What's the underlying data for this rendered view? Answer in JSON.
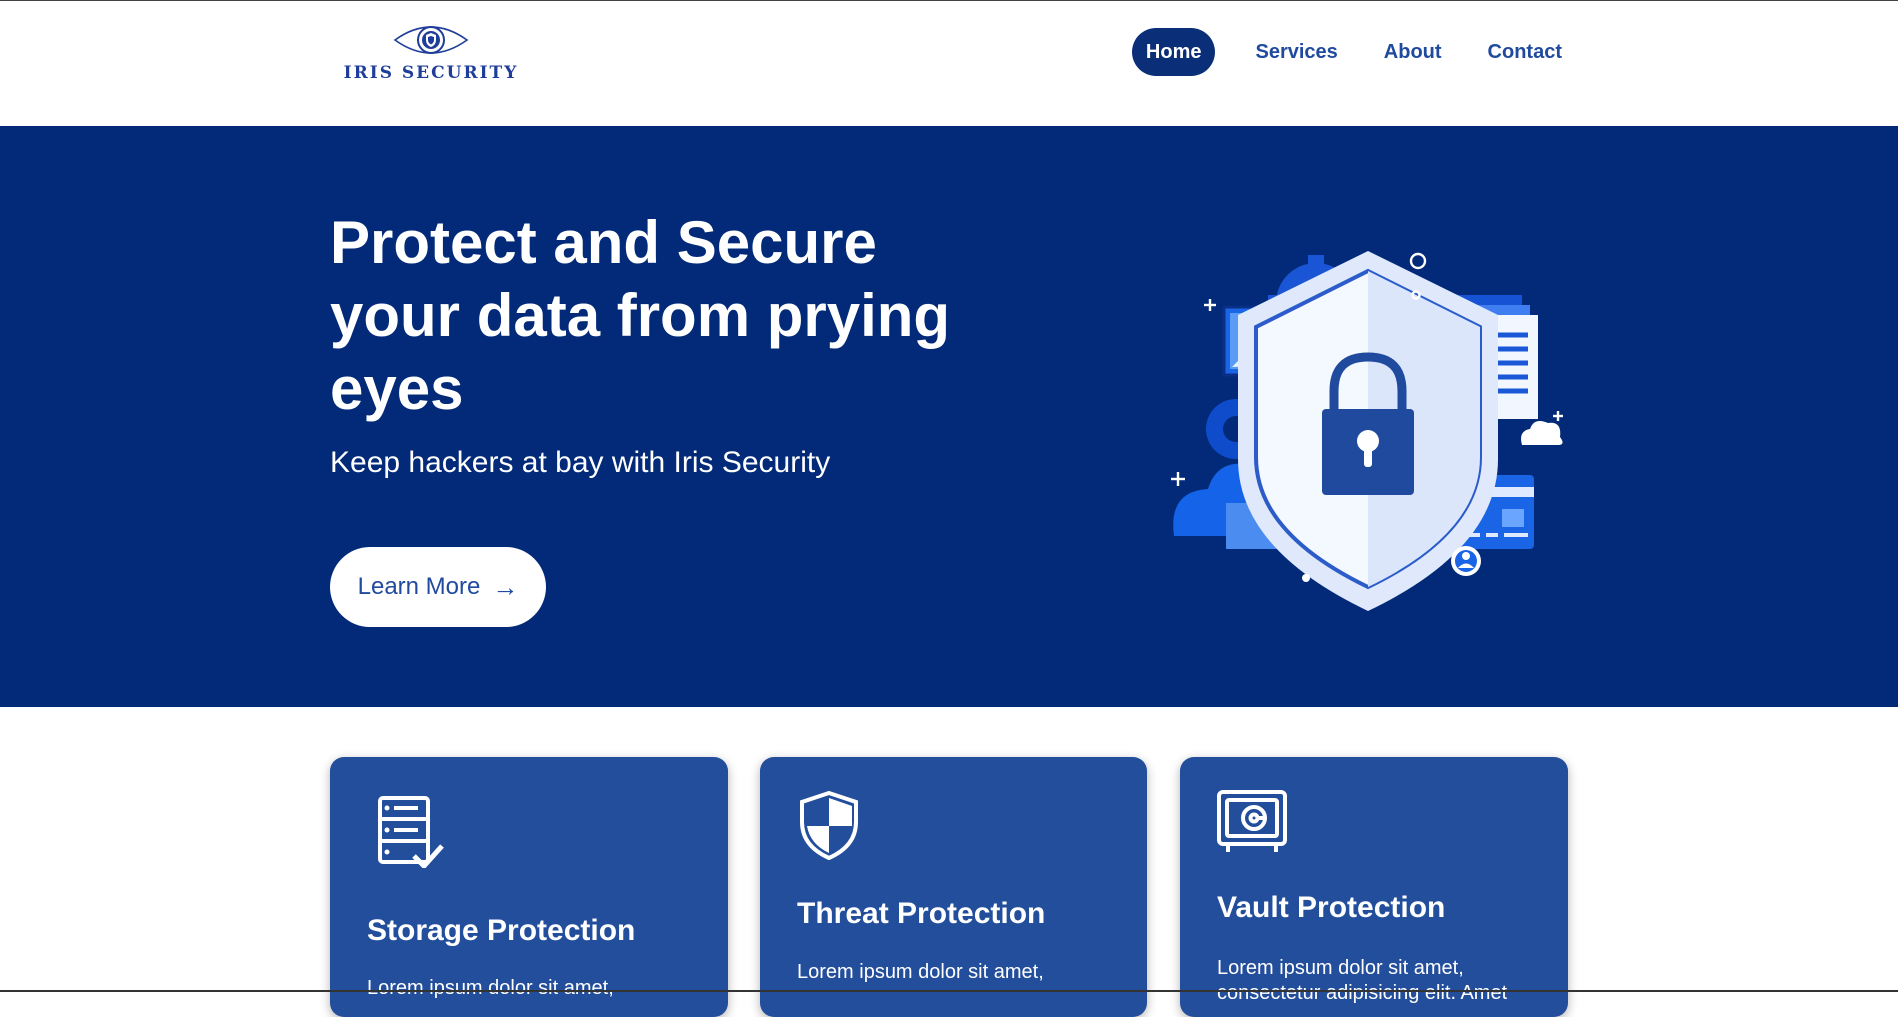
{
  "header": {
    "logo_text": "IRIS SECURITY",
    "nav": [
      {
        "label": "Home",
        "active": true
      },
      {
        "label": "Services",
        "active": false
      },
      {
        "label": "About",
        "active": false
      },
      {
        "label": "Contact",
        "active": false
      }
    ]
  },
  "hero": {
    "title": "Protect and Secure your data from prying eyes",
    "subtitle": "Keep hackers at bay with Iris Security",
    "cta_label": "Learn More",
    "cta_icon": "arrow-right-icon",
    "illustration": "shield-lock-illustration"
  },
  "cards": [
    {
      "icon": "server-check-icon",
      "title": "Storage Protection",
      "text": "Lorem ipsum dolor sit amet,"
    },
    {
      "icon": "shield-icon",
      "title": "Threat Protection",
      "text": "Lorem ipsum dolor sit amet,"
    },
    {
      "icon": "vault-icon",
      "title": "Vault Protection",
      "text": "Lorem ipsum dolor sit amet, consectetur adipisicing elit. Amet"
    }
  ],
  "colors": {
    "hero_bg": "#022a78",
    "card_bg": "#234e9c",
    "nav_active_bg": "#0b2e79",
    "brand_text": "#1f4a9e"
  }
}
